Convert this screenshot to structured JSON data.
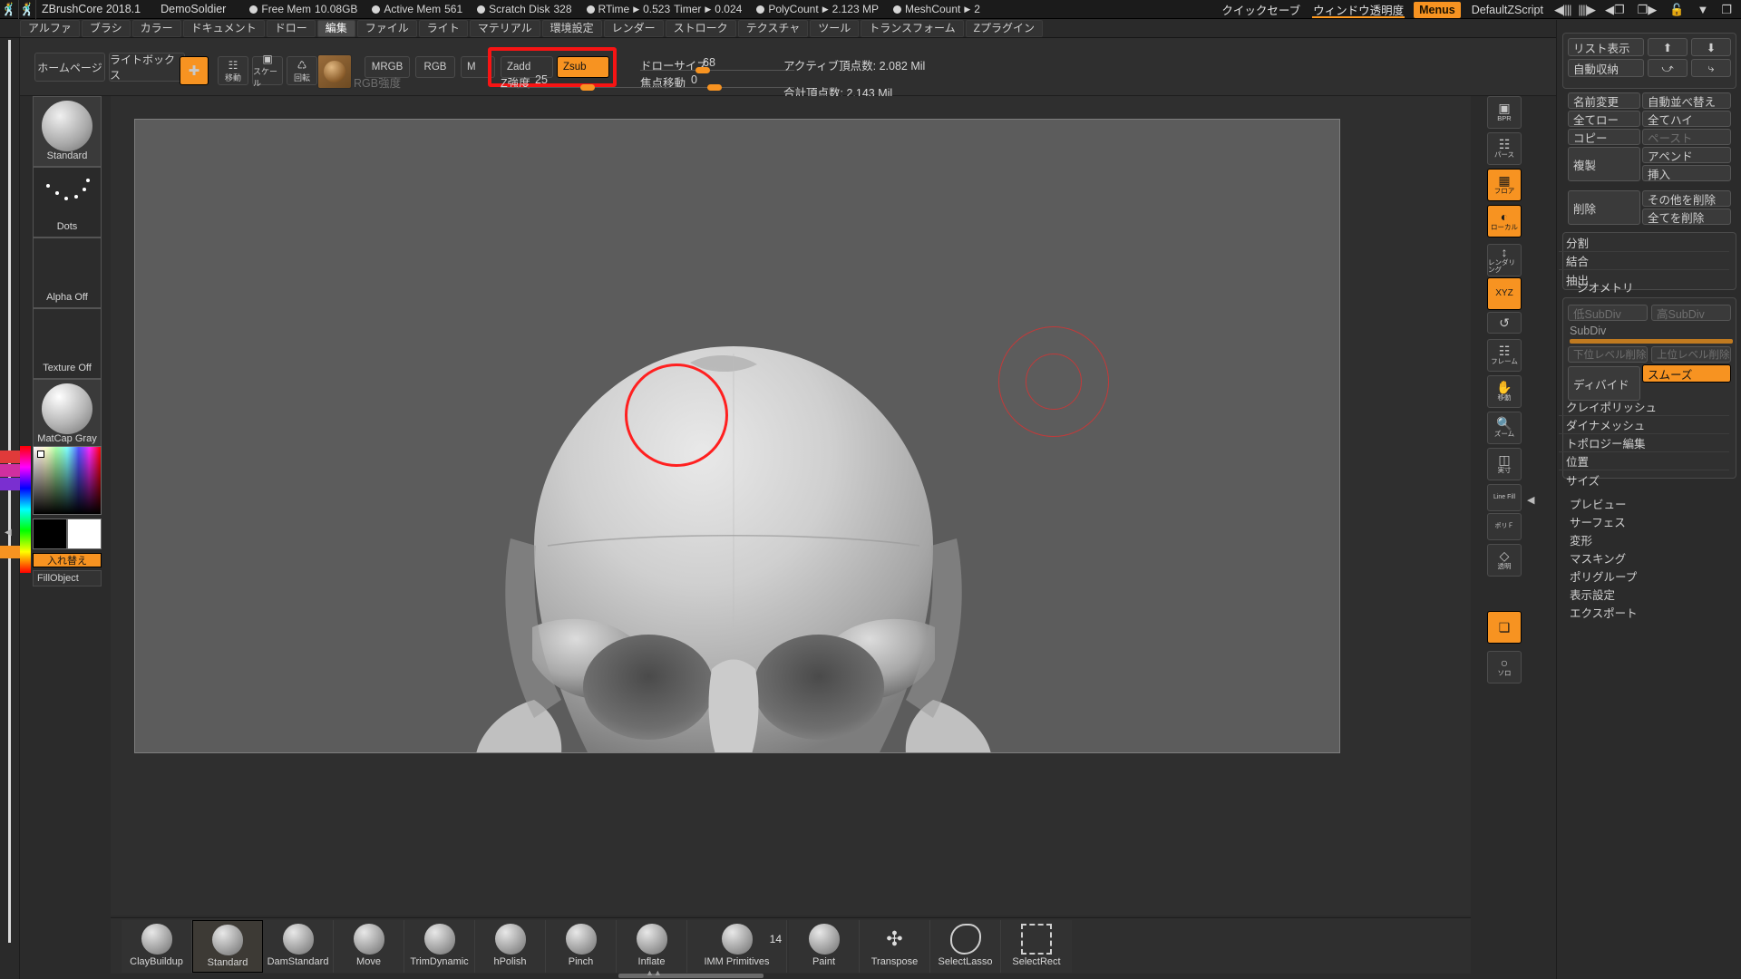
{
  "titlebar": {
    "logo_icon": "zbrush-logo-icon",
    "app_name": "ZBrushCore 2018.1",
    "document_name": "DemoSoldier",
    "stats": [
      {
        "label": "Free Mem",
        "value": "10.08GB",
        "arrow": false
      },
      {
        "label": "Active Mem",
        "value": "561",
        "arrow": false
      },
      {
        "label": "Scratch Disk",
        "value": "328",
        "arrow": false
      },
      {
        "label": "RTime",
        "value": "0.523",
        "arrow": true
      },
      {
        "label": "Timer",
        "value": "0.024",
        "arrow": true
      },
      {
        "label": "PolyCount",
        "value": "2.123 MP",
        "arrow": true
      },
      {
        "label": "MeshCount",
        "value": "2",
        "arrow": true
      }
    ],
    "quick_save": "クイックセーブ",
    "window_transparency": "ウィンドウ透明度",
    "menus_button": "Menus",
    "zscript_name": "DefaultZScript",
    "nav_left_icon": "bars-left-icon",
    "nav_right_icon": "bars-right-icon",
    "win_prev_icon": "window-prev-icon",
    "win_next_icon": "window-next-icon",
    "lock_icon": "lock-open-icon",
    "minimize_icon": "minimize-icon",
    "restore_icon": "restore-window-icon"
  },
  "menubar": {
    "items": [
      {
        "label": "アルファ",
        "active": false
      },
      {
        "label": "ブラシ",
        "active": false
      },
      {
        "label": "カラー",
        "active": false
      },
      {
        "label": "ドキュメント",
        "active": false
      },
      {
        "label": "ドロー",
        "active": false
      },
      {
        "label": "編集",
        "active": true
      },
      {
        "label": "ファイル",
        "active": false
      },
      {
        "label": "ライト",
        "active": false
      },
      {
        "label": "マテリアル",
        "active": false
      },
      {
        "label": "環境設定",
        "active": false
      },
      {
        "label": "レンダー",
        "active": false
      },
      {
        "label": "ストローク",
        "active": false
      },
      {
        "label": "テクスチャ",
        "active": false
      },
      {
        "label": "ツール",
        "active": false
      },
      {
        "label": "トランスフォーム",
        "active": false
      },
      {
        "label": "Zプラグイン",
        "active": false
      }
    ]
  },
  "topshelf": {
    "home_button": "ホームページ",
    "lightbox_button": "ライトボックス",
    "draw_icon": "draw-pointer-icon",
    "move_button": "移動",
    "scale_button": "スケール",
    "rotate_button": "回転",
    "material_icon": "material-sphere-icon",
    "mrgb_button": "MRGB",
    "rgb_button": "RGB",
    "m_button": "M",
    "zadd_button": "Zadd",
    "zsub_button": "Zsub",
    "zsub_selected": true,
    "rgb_intensity_label": "RGB強度",
    "z_intensity_label": "Z強度",
    "z_intensity_value": "25",
    "draw_size_label": "ドローサイズ",
    "draw_size_value": "68",
    "focal_shift_label": "焦点移動",
    "focal_shift_value": "0",
    "active_points_label": "アクティブ頂点数:",
    "active_points_value": "2.082 Mil",
    "total_points_label": "合計頂点数:",
    "total_points_value": "2.143 Mil",
    "annotation_color": "#f71414"
  },
  "leftpalette": {
    "items": [
      {
        "name": "brush-thumbnail",
        "caption": "Standard"
      },
      {
        "name": "stroke-thumbnail",
        "caption": "Dots"
      },
      {
        "name": "alpha-thumbnail",
        "caption": "Alpha Off"
      },
      {
        "name": "texture-thumbnail",
        "caption": "Texture Off"
      },
      {
        "name": "material-thumbnail",
        "caption": "MatCap Gray"
      }
    ],
    "swap_label": "入れ替え",
    "fill_object_label": "FillObject",
    "primary_color": "#ff0000",
    "secondary_color": "#ffffff"
  },
  "rightstrip": {
    "items": [
      {
        "icon": "bpr-icon",
        "caption": "BPR",
        "on": false
      },
      {
        "icon": "perspective-icon",
        "caption": "パース",
        "on": false
      },
      {
        "icon": "floor-grid-icon",
        "caption": "フロア",
        "on": true
      },
      {
        "icon": "local-symmetry-icon",
        "caption": "ローカル",
        "on": true
      },
      {
        "icon": "geometry-hd-icon",
        "caption": "レンダリング",
        "on": false
      },
      {
        "icon": "xyz-axis-icon",
        "caption": "XYZ",
        "on": true
      },
      {
        "icon": "rotate-handle-icon",
        "caption": "",
        "on": false
      },
      {
        "icon": "frame-icon",
        "caption": "フレーム",
        "on": false
      },
      {
        "icon": "move-hand-icon",
        "caption": "移動",
        "on": false
      },
      {
        "icon": "scale-zoom-icon",
        "caption": "ズーム",
        "on": false
      },
      {
        "icon": "actual-size-icon",
        "caption": "実寸",
        "on": false
      },
      {
        "icon": "line-fill-icon",
        "caption": "Line Fill",
        "on": false
      },
      {
        "icon": "polyframe-icon",
        "caption": "ポリＦ",
        "on": false
      },
      {
        "icon": "transparent-icon",
        "caption": "透明",
        "on": false
      },
      {
        "icon": "xpose-icon",
        "caption": "",
        "on": true
      },
      {
        "icon": "solo-icon",
        "caption": "ソロ",
        "on": false
      }
    ]
  },
  "rightpanel": {
    "subtool_group": {
      "list_display": "リスト表示",
      "auto_collapse": "自動収納",
      "up_icon": "arrow-up-icon",
      "down_icon": "arrow-down-icon",
      "move-up-icon": "curve-up-icon",
      "move-down-icon": "curve-down-icon"
    },
    "edit_group": {
      "rename": "名前変更",
      "auto_reorder": "自動並べ替え",
      "all_low": "全てロー",
      "all_high": "全てハイ",
      "copy": "コピー",
      "paste": "ペースト",
      "duplicate": "複製",
      "append": "アペンド",
      "insert": "挿入",
      "delete": "削除",
      "delete_other": "その他を削除",
      "delete_all": "全てを削除"
    },
    "ops_group": {
      "split": "分割",
      "merge": "結合",
      "extract": "抽出"
    },
    "geometry_group": {
      "title": "ジオメトリ",
      "low_subdiv": "低SubDiv",
      "high_subdiv": "高SubDiv",
      "subdiv_label": "SubDiv",
      "del_lower": "下位レベル削除",
      "del_higher": "上位レベル削除",
      "divide": "ディバイド",
      "smooth": "スムーズ",
      "smooth_on": true,
      "clay_polish": "クレイポリッシュ",
      "dynamesh": "ダイナメッシュ",
      "edit_topology": "トポロジー編集",
      "position": "位置",
      "size": "サイズ"
    },
    "bottom_sections": [
      "プレビュー",
      "サーフェス",
      "変形",
      "マスキング",
      "ポリグループ",
      "表示設定",
      "エクスポート"
    ]
  },
  "brushshelf": {
    "brushes": [
      {
        "label": "ClayBuildup",
        "selected": false
      },
      {
        "label": "Standard",
        "selected": true
      },
      {
        "label": "DamStandard",
        "selected": false
      },
      {
        "label": "Move",
        "selected": false
      },
      {
        "label": "TrimDynamic",
        "selected": false
      },
      {
        "label": "hPolish",
        "selected": false
      },
      {
        "label": "Pinch",
        "selected": false
      },
      {
        "label": "Inflate",
        "selected": false
      },
      {
        "label": "IMM Primitives",
        "selected": false,
        "count": "14"
      },
      {
        "label": "Paint",
        "selected": false
      },
      {
        "label": "Transpose",
        "selected": false
      },
      {
        "label": "SelectLasso",
        "selected": false
      },
      {
        "label": "SelectRect",
        "selected": false
      }
    ]
  }
}
